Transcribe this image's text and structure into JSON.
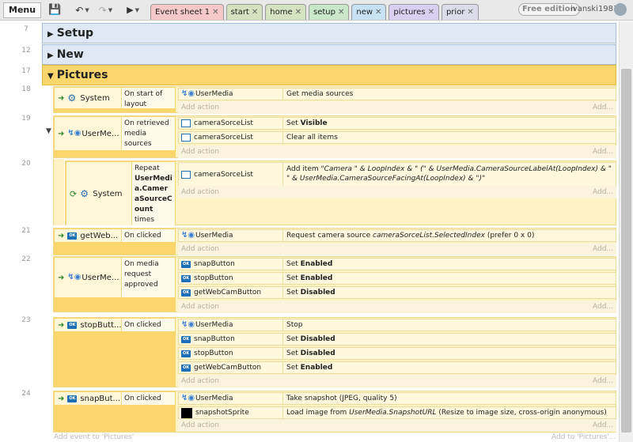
{
  "toolbar": {
    "menu": "Menu",
    "tabs": [
      {
        "label": "Event sheet 1",
        "color": "#f6c9c9"
      },
      {
        "label": "start",
        "color": "#d5e2bf"
      },
      {
        "label": "home",
        "color": "#d4e3c2"
      },
      {
        "label": "setup",
        "color": "#c9e7c9"
      },
      {
        "label": "new",
        "color": "#c7e2f2"
      },
      {
        "label": "pictures",
        "color": "#d9cff0"
      },
      {
        "label": "prior",
        "color": "#dcdcea"
      }
    ],
    "edition_badge": "Free edition",
    "username": "ivanski1983"
  },
  "groups": [
    {
      "num": "7",
      "title": "Setup"
    },
    {
      "num": "12",
      "title": "New"
    },
    {
      "num": "17",
      "title": "Pictures"
    }
  ],
  "events": [
    {
      "num": "18",
      "cond_obj": "System",
      "cond_text": "On start of layout",
      "actions": [
        {
          "obj": "UserMedia",
          "text": "Get media sources"
        }
      ]
    },
    {
      "num": "19",
      "cond_obj": "UserMe...",
      "cond_text": "On retrieved media sources",
      "actions": [
        {
          "obj": "cameraSorceList",
          "prefix": "Set ",
          "bold": "Visible"
        },
        {
          "obj": "cameraSorceList",
          "text": "Clear all items"
        }
      ]
    },
    {
      "num": "20",
      "cond_obj": "System",
      "cond_prefix": "Repeat ",
      "cond_bold": "UserMedia.CameraSourceCount",
      "cond_suffix": " times",
      "actions": [
        {
          "obj": "cameraSorceList",
          "prefix": "Add item ",
          "italic": "\"Camera \" & LoopIndex & \" (\" & UserMedia.CameraSourceLabelAt(LoopIndex) & \" \" & UserMedia.CameraSourceFacingAt(LoopIndex) & \")\""
        }
      ]
    },
    {
      "num": "21",
      "cond_obj": "getWeb...",
      "cond_text": "On clicked",
      "actions": [
        {
          "obj": "UserMedia",
          "prefix": "Request camera source ",
          "italic": "cameraSorceList.SelectedIndex",
          "suffix": " (prefer 0 x 0)"
        }
      ]
    },
    {
      "num": "22",
      "cond_obj": "UserMe...",
      "cond_text": "On media request approved",
      "actions": [
        {
          "obj": "snapButton",
          "prefix": "Set ",
          "bold": "Enabled"
        },
        {
          "obj": "stopButton",
          "prefix": "Set ",
          "bold": "Enabled"
        },
        {
          "obj": "getWebCamButton",
          "prefix": "Set ",
          "bold": "Disabled"
        }
      ]
    },
    {
      "num": "23",
      "cond_obj": "stopButt...",
      "cond_text": "On clicked",
      "actions": [
        {
          "obj": "UserMedia",
          "text": "Stop"
        },
        {
          "obj": "snapButton",
          "prefix": "Set ",
          "bold": "Disabled"
        },
        {
          "obj": "stopButton",
          "prefix": "Set ",
          "bold": "Disabled"
        },
        {
          "obj": "getWebCamButton",
          "prefix": "Set ",
          "bold": "Enabled"
        }
      ]
    },
    {
      "num": "24",
      "cond_obj": "snapBut...",
      "cond_text": "On clicked",
      "actions": [
        {
          "obj": "UserMedia",
          "text": "Take snapshot (JPEG, quality 5)"
        },
        {
          "obj": "snapshotSprite",
          "prefix": "Load image from ",
          "italic": "UserMedia.SnapshotURL",
          "suffix": " (Resize to image size, cross-origin anonymous)"
        }
      ]
    }
  ],
  "labels": {
    "add_action": "Add action",
    "add_action_right": "Add...",
    "add_event": "Add event to 'Pictures'",
    "add_to": "Add to 'Pictures'..."
  },
  "icons": {
    "save": "floppy-disk-icon",
    "undo": "undo-icon",
    "redo": "redo-icon",
    "preview": "play-icon",
    "system": "gear-icon",
    "user_media": "user-media-icon",
    "list": "list-icon",
    "button": "button-icon",
    "sprite": "sprite-icon",
    "loop": "loop-icon"
  }
}
